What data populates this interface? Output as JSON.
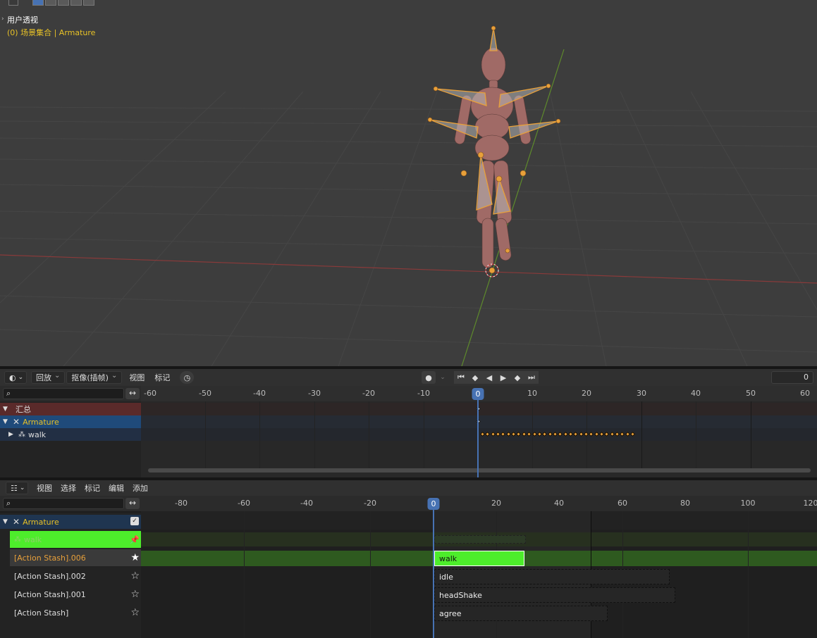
{
  "viewport": {
    "title": "用户透视",
    "collection": "(0) 场景集合",
    "object": "Armature",
    "separator": "|"
  },
  "timeline": {
    "menus": [
      "回放",
      "抠像(插帧)",
      "视图",
      "标记"
    ],
    "current_frame": "0",
    "ruler_ticks": [
      "-60",
      "-50",
      "-40",
      "-30",
      "-20",
      "-10",
      "0",
      "10",
      "20",
      "30",
      "40",
      "50",
      "60"
    ],
    "cursor_label": "0",
    "channels": [
      {
        "label": "汇总",
        "color": "#5a2a2a",
        "text_color": "#dddddd"
      },
      {
        "label": "Armature",
        "color": "#1f4a7a",
        "text_color": "#e8c227"
      },
      {
        "label": "walk",
        "color": "#222f44",
        "text_color": "#dddddd"
      }
    ],
    "keyframe_count": 30
  },
  "nla": {
    "menus": [
      "视图",
      "选择",
      "标记",
      "编辑",
      "添加"
    ],
    "ruler_ticks": [
      "-80",
      "-60",
      "-40",
      "-20",
      "0",
      "20",
      "40",
      "60",
      "80",
      "100",
      "120"
    ],
    "cursor_label": "0",
    "object": "Armature",
    "tracks": [
      {
        "label": "walk",
        "kind": "action"
      },
      {
        "label": "[Action Stash].006",
        "kind": "track",
        "highlight": true
      },
      {
        "label": "[Action Stash].002",
        "kind": "track"
      },
      {
        "label": "[Action Stash].001",
        "kind": "track"
      },
      {
        "label": "[Action Stash]",
        "kind": "track"
      }
    ],
    "strips": [
      {
        "label": "walk",
        "start": 0,
        "end": 29,
        "color": "#4ded2b"
      },
      {
        "label": "idle",
        "start": 0,
        "end": 75
      },
      {
        "label": "headShake",
        "start": 0,
        "end": 77
      },
      {
        "label": "agree",
        "start": 0,
        "end": 55
      }
    ]
  },
  "colors": {
    "accent": "#4772b3",
    "active_green": "#4ded2b",
    "keyframe": "#e8a03a"
  }
}
